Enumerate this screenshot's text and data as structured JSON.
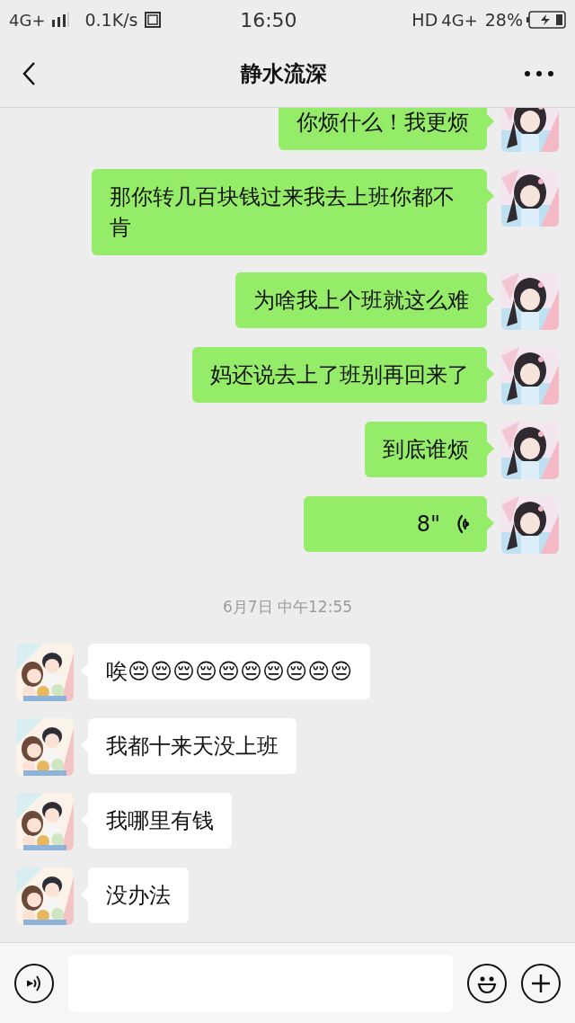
{
  "status_bar": {
    "network_left": "4G+",
    "speed": "0.1K/s",
    "time": "16:50",
    "hd": "HD",
    "network_right": "4G+",
    "battery": "28%"
  },
  "header": {
    "title": "静水流深"
  },
  "messages": [
    {
      "kind": "text",
      "outgoing": true,
      "text": "你烦什么！我更烦"
    },
    {
      "kind": "text",
      "outgoing": true,
      "text": "那你转几百块钱过来我去上班你都不肯"
    },
    {
      "kind": "text",
      "outgoing": true,
      "text": "为啥我上个班就这么难"
    },
    {
      "kind": "text",
      "outgoing": true,
      "text": "妈还说去上了班别再回来了"
    },
    {
      "kind": "text",
      "outgoing": true,
      "text": "到底谁烦"
    },
    {
      "kind": "voice",
      "outgoing": true,
      "text": "8\""
    },
    {
      "kind": "time",
      "text": "6月7日 中午12:55"
    },
    {
      "kind": "text",
      "outgoing": false,
      "text": "唉😔😔😔😔😔😔😔😔😔😔"
    },
    {
      "kind": "text",
      "outgoing": false,
      "text": "我都十来天没上班"
    },
    {
      "kind": "text",
      "outgoing": false,
      "text": "我哪里有钱"
    },
    {
      "kind": "text",
      "outgoing": false,
      "text": "没办法"
    }
  ]
}
